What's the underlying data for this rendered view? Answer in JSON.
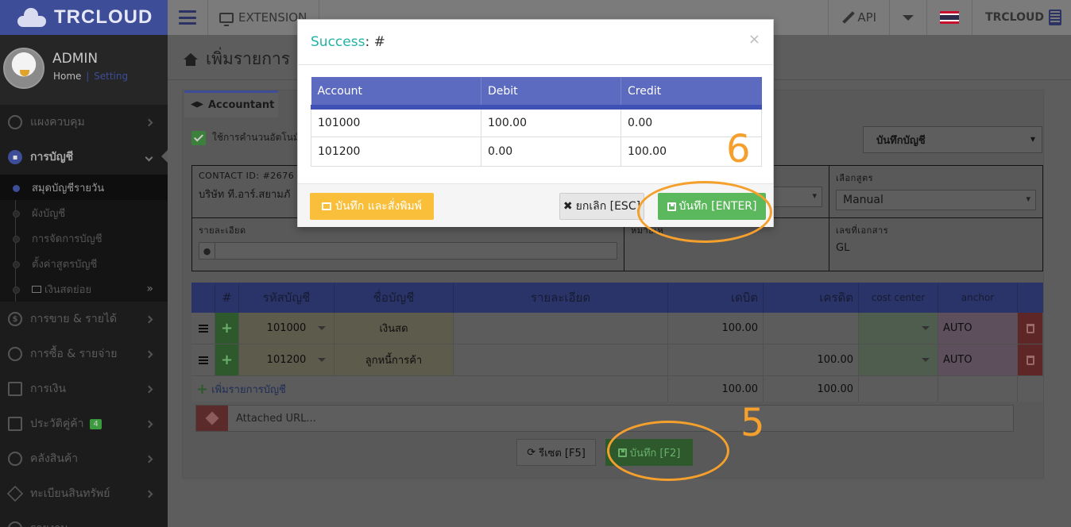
{
  "topbar": {
    "logo_text": "TRCLOUD",
    "extension_label": "EXTENSION",
    "api_label": "API",
    "brand_label": "TRCLOUD"
  },
  "profile": {
    "name": "ADMIN",
    "home_link": "Home",
    "separator": "|",
    "setting_link": "Setting"
  },
  "sidebar": {
    "items": [
      {
        "label": "แผงควบคุม",
        "icon": "monitor-icon"
      },
      {
        "label": "การบัญชี",
        "icon": "book-icon"
      },
      {
        "label": "การขาย & รายได้",
        "icon": "dollar-icon"
      },
      {
        "label": "การซื้อ & รายจ่าย",
        "icon": "cart-icon"
      },
      {
        "label": "การเงิน",
        "icon": "calendar-icon"
      },
      {
        "label": "ประวัติคู่ค้า",
        "icon": "contact-icon",
        "badge": "4"
      },
      {
        "label": "คลังสินค้า",
        "icon": "cubes-icon"
      },
      {
        "label": "ทะเบียนสินทรัพย์",
        "icon": "diamond-icon"
      },
      {
        "label": "รายงาน",
        "icon": "chart-icon"
      }
    ],
    "subitems": [
      {
        "label": "สมุดบัญชีรายวัน"
      },
      {
        "label": "ผังบัญชี"
      },
      {
        "label": "การจัดการบัญชี"
      },
      {
        "label": "ตั้งค่าสูตรบัญชี"
      },
      {
        "label": "เงินสดย่อย",
        "suffix": "»"
      }
    ]
  },
  "page": {
    "title": "เพิ่มรายการ",
    "tab_label": "Accountant",
    "auto_calc_label": "ใช้การคำนวนอัตโนมั",
    "save_account_select": "บันทึกบัญชี",
    "contact_label": "CONTACT ID: #2676",
    "contact_value": "บริษัท ที.อาร์.สยามภั",
    "formula_label": "เลือกสูตร",
    "formula_value": "Manual",
    "detail_label": "รายละเอียด",
    "note_label": "หมายเห",
    "doc_no_label": "เลขที่เอกสาร",
    "doc_no_value": "GL"
  },
  "entries": {
    "headers": [
      "#",
      "รหัสบัญชี",
      "ชื่อบัญชี",
      "รายละเอียด",
      "เดบิต",
      "เครดิต",
      "cost center",
      "anchor"
    ],
    "rows": [
      {
        "code": "101000",
        "name": "เงินสด",
        "detail": "",
        "debit": "100.00",
        "credit": "",
        "anchor": "AUTO"
      },
      {
        "code": "101200",
        "name": "ลูกหนี้การค้า",
        "detail": "",
        "debit": "",
        "credit": "100.00",
        "anchor": "AUTO"
      }
    ],
    "add_label": "เพิ่มรายการบัญชี",
    "total_debit": "100.00",
    "total_credit": "100.00",
    "url_placeholder": "Attached URL...",
    "reset_label": "รีเซต [F5]",
    "save_label": "บันทึก [F2]"
  },
  "annotations": {
    "step5": "5",
    "step6": "6",
    "color": "#f5a02c"
  },
  "modal": {
    "title_prefix": "Success",
    "title_suffix": ": #",
    "close": "×",
    "columns": [
      "Account",
      "Debit",
      "Credit"
    ],
    "rows": [
      {
        "account": "101000",
        "debit": "100.00",
        "credit": "0.00"
      },
      {
        "account": "101200",
        "debit": "0.00",
        "credit": "100.00"
      }
    ],
    "print_label": "บันทึก และสั่งพิมพ์",
    "cancel_label": "ยกเลิก [ESC]",
    "save_label": "บันทึก [ENTER]"
  },
  "colors": {
    "brand": "#3d4d97",
    "success": "#23b3a4",
    "save_green": "#5cb85c",
    "print_yellow": "#f9bf3b",
    "table_header": "#5c6bc0"
  }
}
